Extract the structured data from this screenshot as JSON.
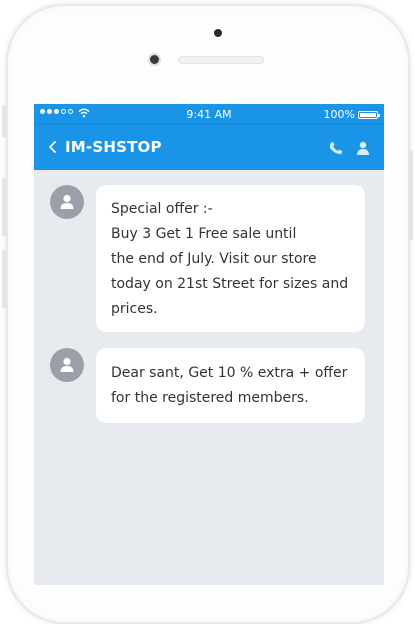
{
  "status_bar": {
    "time": "9:41 AM",
    "battery": "100%",
    "battery_level": 1.0,
    "signal_bars": 3
  },
  "header": {
    "contact_name": "IM-SHSTOP",
    "color": "#1a94e6"
  },
  "messages": [
    {
      "lines": [
        "Special offer :-",
        "Buy 3 Get 1 Free sale until",
        "the end of July. Visit our store",
        "today on 21st Street for sizes and",
        "prices."
      ]
    },
    {
      "lines": [
        "Dear sant, Get 10 % extra + offer",
        "for the registered members."
      ]
    }
  ],
  "icons": {
    "back": "chevron-left-icon",
    "call": "phone-icon",
    "contact": "person-icon",
    "avatar": "person-icon"
  }
}
